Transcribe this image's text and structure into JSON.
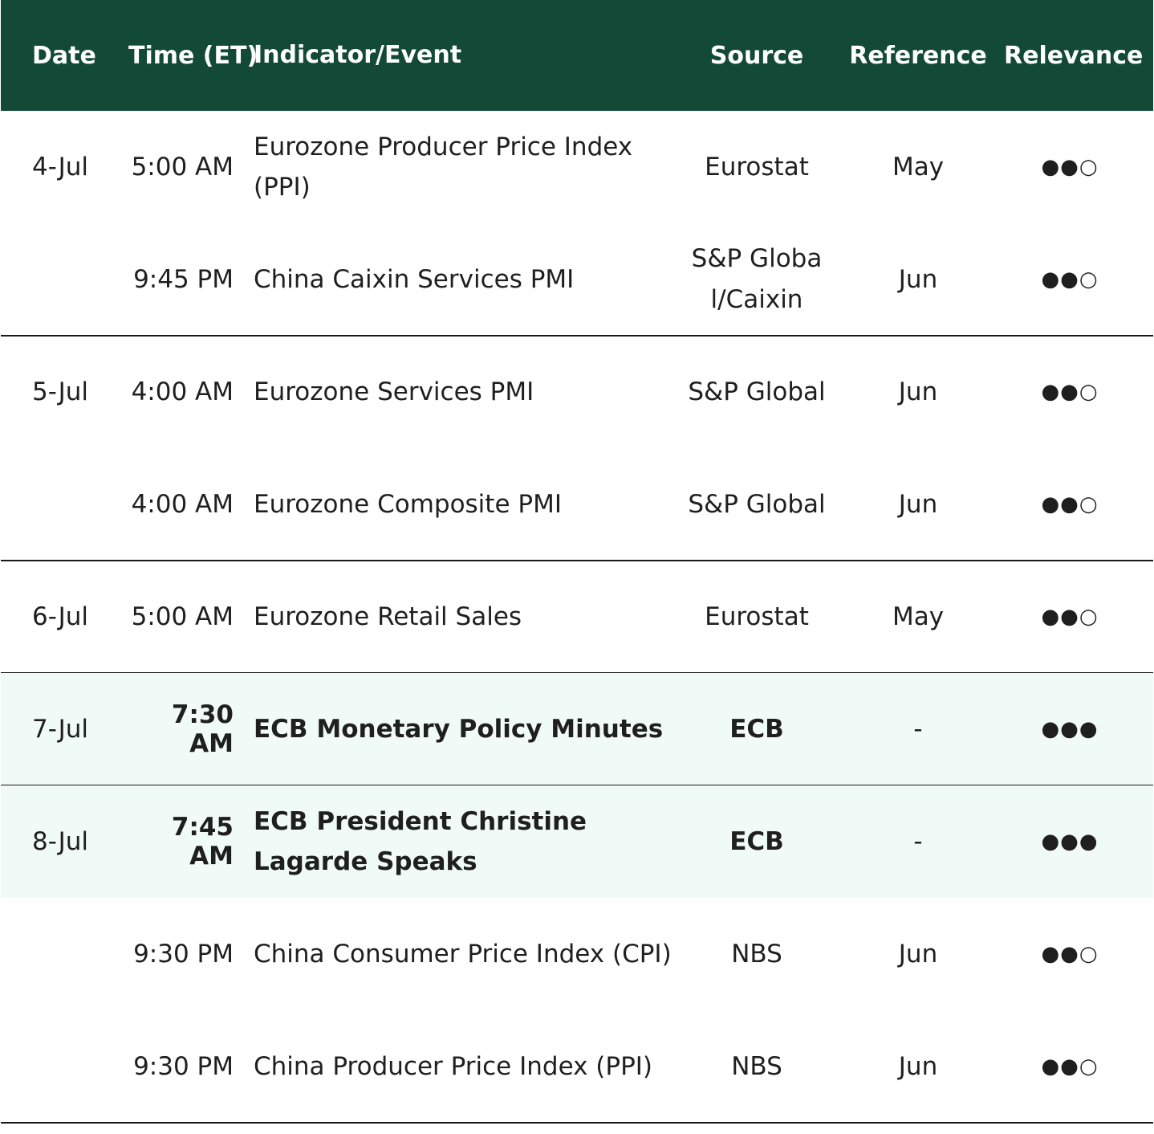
{
  "header": {
    "date": "Date",
    "time": "Time (ET)",
    "event": "Indicator/Event",
    "source": "Source",
    "reference": "Reference",
    "relevance": "Relevance"
  },
  "rows": [
    {
      "date": "4-Jul",
      "time": "5:00 AM",
      "event": "Eurozone Producer Price Index (PPI)",
      "source": "Eurostat",
      "reference": "May",
      "relevance": "●●○"
    },
    {
      "date": "",
      "time": "9:45 PM",
      "event": "China Caixin Services PMI",
      "source": "S&P Global/Caixin",
      "reference": "Jun",
      "relevance": "●●○"
    },
    {
      "date": "5-Jul",
      "time": "4:00 AM",
      "event": "Eurozone Services PMI",
      "source": "S&P Global",
      "reference": "Jun",
      "relevance": "●●○"
    },
    {
      "date": "",
      "time": "4:00 AM",
      "event": "Eurozone Composite PMI",
      "source": "S&P Global",
      "reference": "Jun",
      "relevance": "●●○"
    },
    {
      "date": "6-Jul",
      "time": "5:00 AM",
      "event": "Eurozone Retail Sales",
      "source": "Eurostat",
      "reference": "May",
      "relevance": "●●○"
    },
    {
      "date": "7-Jul",
      "time": "7:30 AM",
      "event": "ECB Monetary Policy Minutes",
      "source": "ECB",
      "reference": "-",
      "relevance": "●●●"
    },
    {
      "date": "8-Jul",
      "time": "7:45 AM",
      "event": "ECB President Christine Lagarde Speaks",
      "source": "ECB",
      "reference": "-",
      "relevance": "●●●"
    },
    {
      "date": "",
      "time": "9:30 PM",
      "event": "China Consumer Price Index (CPI)",
      "source": "NBS",
      "reference": "Jun",
      "relevance": "●●○"
    },
    {
      "date": "",
      "time": "9:30 PM",
      "event": "China Producer Price Index (PPI)",
      "source": "NBS",
      "reference": "Jun",
      "relevance": "●●○"
    }
  ],
  "colors": {
    "header_bg": "#134a37",
    "highlight_bg": "#f0faf6",
    "rule": "#1a1a1a"
  }
}
